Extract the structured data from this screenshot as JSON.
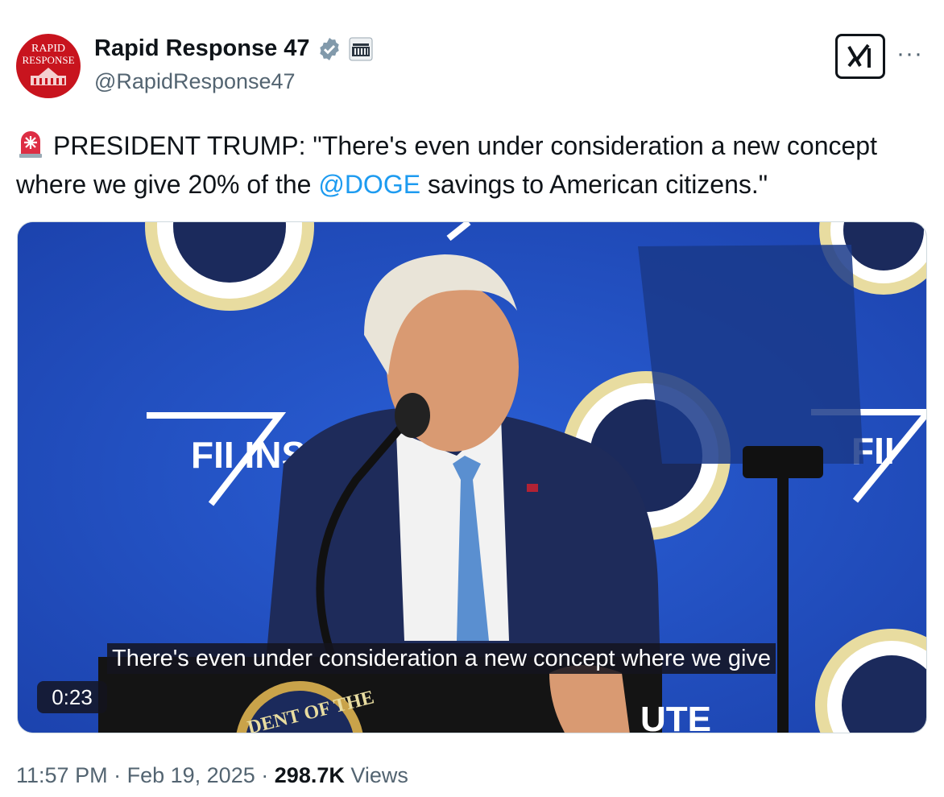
{
  "author": {
    "display_name": "Rapid Response 47",
    "handle": "@RapidResponse47",
    "avatar_text_line1": "RAPID",
    "avatar_text_line2": "RESPONSE",
    "verified_icon": "verified-badge-icon",
    "affiliation_icon": "white-house-icon"
  },
  "header": {
    "grok_button_label": "x⁄I",
    "more_label": "···"
  },
  "tweet": {
    "emoji_icon": "siren-icon",
    "text_before": "PRESIDENT TRUMP: \"There's even under consideration a new concept where we give 20% of the ",
    "mention": "@DOGE",
    "text_after": " savings to American citizens.\""
  },
  "media": {
    "caption": "There's even under consideration a new concept where we give",
    "duration": "0:23",
    "backdrop_text_left": "FII INSTI",
    "backdrop_text_right": "FII",
    "podium_text": "DENT OF THE",
    "podium_text_right": "UTE"
  },
  "footer": {
    "time": "11:57 PM",
    "separator": "·",
    "date": "Feb 19, 2025",
    "views_count": "298.7K",
    "views_label": "Views"
  },
  "colors": {
    "accent": "#1d9bf0",
    "muted_text": "#536471",
    "avatar_red": "#c8141e",
    "stage_blue": "#1f4fbf"
  }
}
